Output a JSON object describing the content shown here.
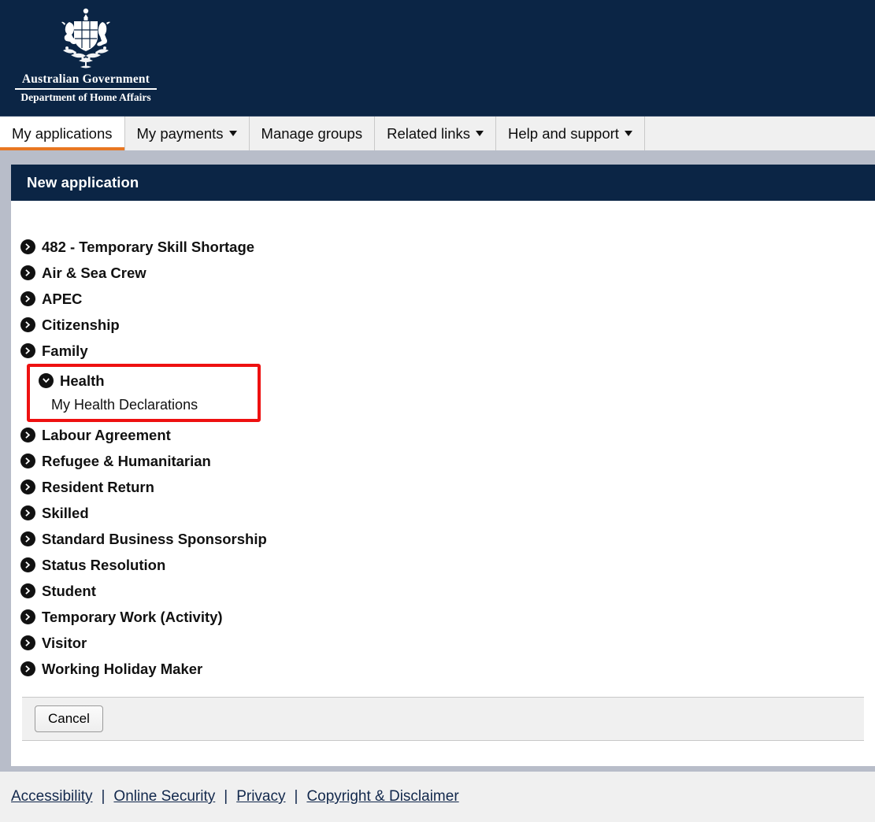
{
  "masthead": {
    "crest_icon": "australian-coat-of-arms",
    "line1": "Australian Government",
    "line2": "Department of Home Affairs",
    "background_color": "#0b2545"
  },
  "navbar": {
    "active_accent_color": "#e87722",
    "tabs": [
      {
        "label": "My applications",
        "has_caret": false,
        "active": true
      },
      {
        "label": "My payments",
        "has_caret": true,
        "active": false
      },
      {
        "label": "Manage groups",
        "has_caret": false,
        "active": false
      },
      {
        "label": "Related links",
        "has_caret": true,
        "active": false
      },
      {
        "label": "Help and support",
        "has_caret": true,
        "active": false
      }
    ]
  },
  "card": {
    "header_title": "New application",
    "header_color": "#0b2545"
  },
  "application_list": {
    "before_health": [
      {
        "label": "482 - Temporary Skill Shortage",
        "icon": "chevron-right-circle-icon"
      },
      {
        "label": "Air & Sea Crew",
        "icon": "chevron-right-circle-icon"
      },
      {
        "label": "APEC",
        "icon": "chevron-right-circle-icon"
      },
      {
        "label": "Citizenship",
        "icon": "chevron-right-circle-icon"
      },
      {
        "label": "Family",
        "icon": "chevron-right-circle-icon"
      }
    ],
    "health": {
      "label": "Health",
      "icon": "chevron-down-circle-icon",
      "expanded": true,
      "highlight_color": "#ee1111",
      "children": [
        {
          "label": "My Health Declarations"
        }
      ]
    },
    "after_health": [
      {
        "label": "Labour Agreement",
        "icon": "chevron-right-circle-icon"
      },
      {
        "label": "Refugee & Humanitarian",
        "icon": "chevron-right-circle-icon"
      },
      {
        "label": "Resident Return",
        "icon": "chevron-right-circle-icon"
      },
      {
        "label": "Skilled",
        "icon": "chevron-right-circle-icon"
      },
      {
        "label": "Standard Business Sponsorship",
        "icon": "chevron-right-circle-icon"
      },
      {
        "label": "Status Resolution",
        "icon": "chevron-right-circle-icon"
      },
      {
        "label": "Student",
        "icon": "chevron-right-circle-icon"
      },
      {
        "label": "Temporary Work (Activity)",
        "icon": "chevron-right-circle-icon"
      },
      {
        "label": "Visitor",
        "icon": "chevron-right-circle-icon"
      },
      {
        "label": "Working Holiday Maker",
        "icon": "chevron-right-circle-icon"
      }
    ]
  },
  "actions": {
    "cancel_label": "Cancel"
  },
  "footer": {
    "separator": "|",
    "links": [
      {
        "label": "Accessibility"
      },
      {
        "label": "Online Security"
      },
      {
        "label": "Privacy"
      },
      {
        "label": "Copyright & Disclaimer"
      }
    ]
  }
}
